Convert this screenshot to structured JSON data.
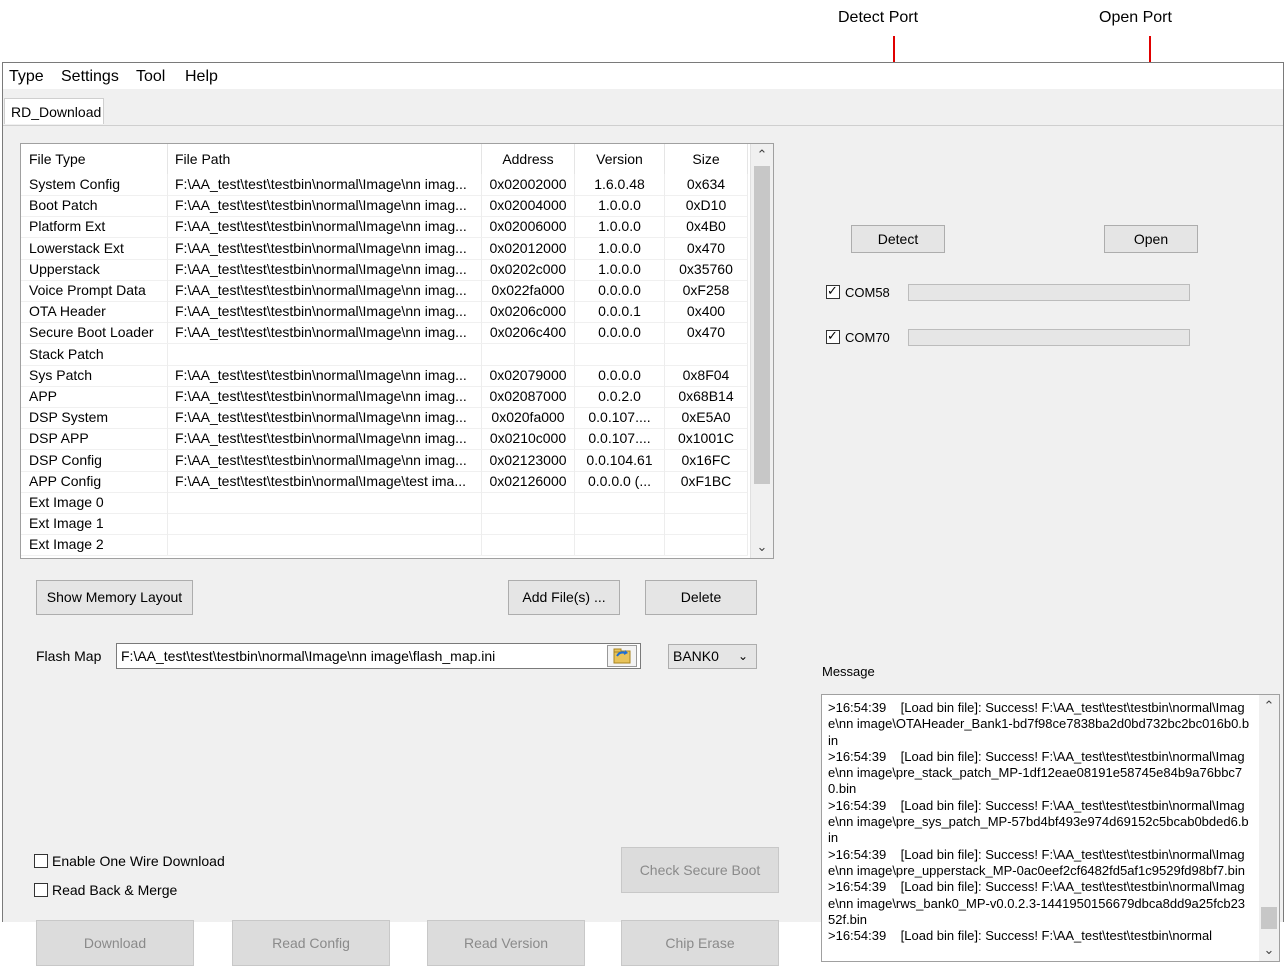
{
  "annotations": {
    "detect_port": "Detect Port",
    "open_port": "Open Port"
  },
  "menu": [
    "Type",
    "Settings",
    "Tool",
    "Help"
  ],
  "tab": "RD_Download",
  "table": {
    "headers": [
      "File Type",
      "File Path",
      "Address",
      "Version",
      "Size"
    ],
    "rows": [
      [
        "System Config",
        "F:\\AA_test\\test\\testbin\\normal\\Image\\nn imag...",
        "0x02002000",
        "1.6.0.48",
        "0x634"
      ],
      [
        "Boot Patch",
        "F:\\AA_test\\test\\testbin\\normal\\Image\\nn imag...",
        "0x02004000",
        "1.0.0.0",
        "0xD10"
      ],
      [
        "Platform Ext",
        "F:\\AA_test\\test\\testbin\\normal\\Image\\nn imag...",
        "0x02006000",
        "1.0.0.0",
        "0x4B0"
      ],
      [
        "Lowerstack Ext",
        "F:\\AA_test\\test\\testbin\\normal\\Image\\nn imag...",
        "0x02012000",
        "1.0.0.0",
        "0x470"
      ],
      [
        "Upperstack",
        "F:\\AA_test\\test\\testbin\\normal\\Image\\nn imag...",
        "0x0202c000",
        "1.0.0.0",
        "0x35760"
      ],
      [
        "Voice Prompt Data",
        "F:\\AA_test\\test\\testbin\\normal\\Image\\nn imag...",
        "0x022fa000",
        "0.0.0.0",
        "0xF258"
      ],
      [
        "OTA Header",
        "F:\\AA_test\\test\\testbin\\normal\\Image\\nn imag...",
        "0x0206c000",
        "0.0.0.1",
        "0x400"
      ],
      [
        "Secure Boot Loader",
        "F:\\AA_test\\test\\testbin\\normal\\Image\\nn imag...",
        "0x0206c400",
        "0.0.0.0",
        "0x470"
      ],
      [
        "Stack Patch",
        "",
        "",
        "",
        ""
      ],
      [
        "Sys Patch",
        "F:\\AA_test\\test\\testbin\\normal\\Image\\nn imag...",
        "0x02079000",
        "0.0.0.0",
        "0x8F04"
      ],
      [
        "APP",
        "F:\\AA_test\\test\\testbin\\normal\\Image\\nn imag...",
        "0x02087000",
        "0.0.2.0",
        "0x68B14"
      ],
      [
        "DSP System",
        "F:\\AA_test\\test\\testbin\\normal\\Image\\nn imag...",
        "0x020fa000",
        "0.0.107....",
        "0xE5A0"
      ],
      [
        "DSP APP",
        "F:\\AA_test\\test\\testbin\\normal\\Image\\nn imag...",
        "0x0210c000",
        "0.0.107....",
        "0x1001C"
      ],
      [
        "DSP Config",
        "F:\\AA_test\\test\\testbin\\normal\\Image\\nn imag...",
        "0x02123000",
        "0.0.104.61",
        "0x16FC"
      ],
      [
        "APP Config",
        "F:\\AA_test\\test\\testbin\\normal\\Image\\test ima...",
        "0x02126000",
        "0.0.0.0 (...",
        "0xF1BC"
      ],
      [
        "Ext Image 0",
        "",
        "",
        "",
        ""
      ],
      [
        "Ext Image 1",
        "",
        "",
        "",
        ""
      ],
      [
        "Ext Image 2",
        "",
        "",
        "",
        ""
      ]
    ]
  },
  "buttons": {
    "show_memory_layout": "Show Memory Layout",
    "add_files": "Add File(s) ...",
    "delete": "Delete",
    "detect": "Detect",
    "open": "Open",
    "check_secure_boot": "Check Secure Boot",
    "download": "Download",
    "read_config": "Read Config",
    "read_version": "Read Version",
    "chip_erase": "Chip Erase"
  },
  "flash_map": {
    "label": "Flash Map",
    "value": "F:\\AA_test\\test\\testbin\\normal\\Image\\nn image\\flash_map.ini",
    "bank": "BANK0"
  },
  "ports": [
    {
      "name": "COM58",
      "checked": true
    },
    {
      "name": "COM70",
      "checked": true
    }
  ],
  "options": {
    "one_wire": "Enable One Wire Download",
    "read_back": "Read Back & Merge"
  },
  "message": {
    "label": "Message",
    "lines": [
      ">16:54:39    [Load bin file]: Success! F:\\AA_test\\test\\testbin\\normal\\Image\\nn image\\OTAHeader_Bank1-bd7f98ce7838ba2d0bd732bc2bc016b0.bin",
      ">16:54:39    [Load bin file]: Success! F:\\AA_test\\test\\testbin\\normal\\Image\\nn image\\pre_stack_patch_MP-1df12eae08191e58745e84b9a76bbc70.bin",
      ">16:54:39    [Load bin file]: Success! F:\\AA_test\\test\\testbin\\normal\\Image\\nn image\\pre_sys_patch_MP-57bd4bf493e974d69152c5bcab0bded6.bin",
      ">16:54:39    [Load bin file]: Success! F:\\AA_test\\test\\testbin\\normal\\Image\\nn image\\pre_upperstack_MP-0ac0eef2cf6482fd5af1c9529fd98bf7.bin",
      ">16:54:39    [Load bin file]: Success! F:\\AA_test\\test\\testbin\\normal\\Image\\nn image\\rws_bank0_MP-v0.0.2.3-1441950156679dbca8dd9a25fcb2352f.bin",
      ">16:54:39    [Load bin file]: Success! F:\\AA_test\\test\\testbin\\normal"
    ]
  }
}
